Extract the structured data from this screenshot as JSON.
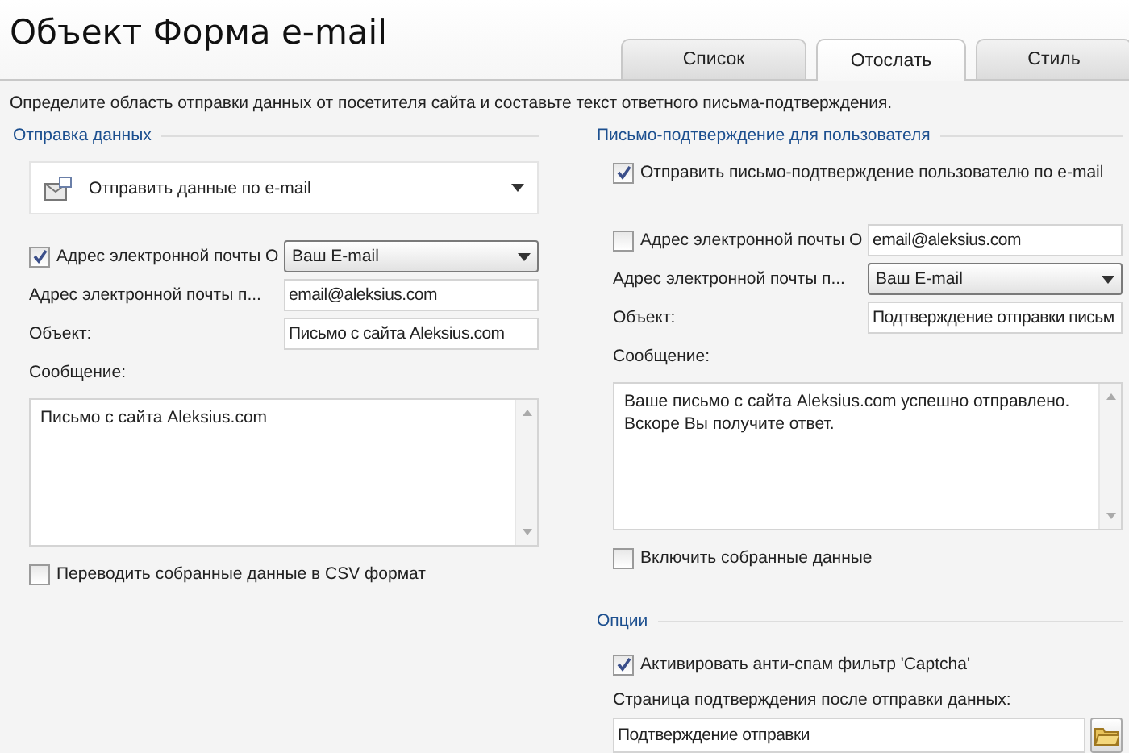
{
  "title": "Объект Форма e-mail",
  "tabs": [
    {
      "label": "Список",
      "selected": false
    },
    {
      "label": "Отослать",
      "selected": true
    },
    {
      "label": "Стиль",
      "selected": false
    }
  ],
  "description": "Определите область отправки данных от посетителя сайта и составьте текст ответного письма-подтверждения.",
  "left": {
    "heading": "Отправка данных",
    "action": "Отправить данные по e-mail",
    "rows": [
      {
        "kind": "checkbox-select",
        "label": "Адрес электронной почты О",
        "checked": true,
        "value": "Ваш E-mail"
      },
      {
        "kind": "input",
        "label": "Адрес электронной почты п...",
        "value": "email@aleksius.com"
      },
      {
        "kind": "input",
        "label": "Объект:",
        "value": "Письмо с сайта Aleksius.com"
      }
    ],
    "message": {
      "label": "Сообщение:",
      "value": "Письмо с сайта Aleksius.com"
    },
    "footer": {
      "label": "Переводить собранные данные в CSV формат",
      "checked": false
    }
  },
  "right": {
    "heading": "Письмо-подтверждение для пользователя",
    "send": {
      "label": "Отправить письмо-подтверждение пользователю по e-mail",
      "checked": true
    },
    "rows": [
      {
        "kind": "checkbox-input",
        "label": "Адрес электронной почты О",
        "checked": false,
        "value": "email@aleksius.com"
      },
      {
        "kind": "select",
        "label": "Адрес электронной почты п...",
        "value": "Ваш E-mail"
      },
      {
        "kind": "input",
        "label": "Объект:",
        "value": "Подтверждение отправки письм"
      }
    ],
    "message": {
      "label": "Сообщение:",
      "value": "Ваше письмо с сайта Aleksius.com успешно отправлено.\nВскоре Вы получите ответ."
    },
    "footer": {
      "label": "Включить собранные данные",
      "checked": false
    }
  },
  "options": {
    "heading": "Опции",
    "captcha": {
      "label": "Активировать анти-спам фильтр 'Captcha'",
      "checked": true
    },
    "page_label": "Страница подтверждения после отправки данных:",
    "page_value": "Подтверждение отправки"
  }
}
